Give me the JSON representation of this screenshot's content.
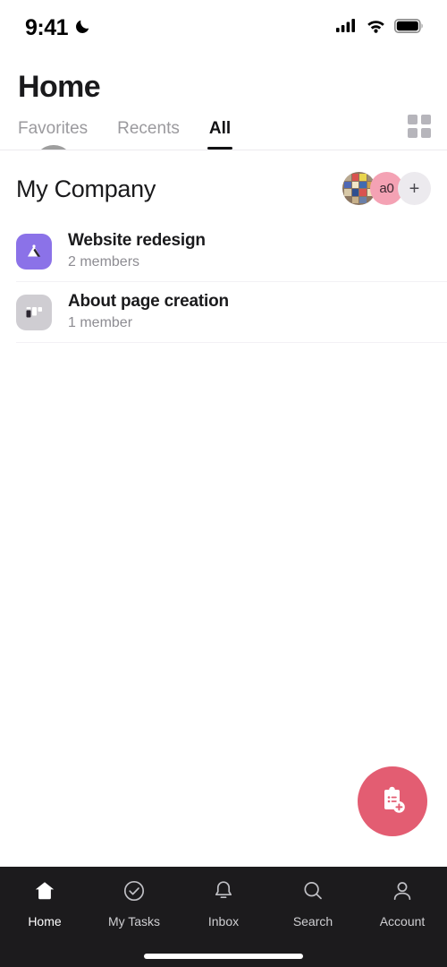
{
  "status_bar": {
    "time": "9:41",
    "dnd_icon": "moon-icon",
    "signal_icon": "cellular-signal-icon",
    "wifi_icon": "wifi-icon",
    "battery_icon": "battery-full-icon"
  },
  "header": {
    "title": "Home",
    "avatar": {
      "name": "user-avatar",
      "color": "#9e9e9e"
    },
    "grid_toggle_icon": "grid-view-icon"
  },
  "tabs": [
    {
      "label": "Favorites",
      "active": false
    },
    {
      "label": "Recents",
      "active": false
    },
    {
      "label": "All",
      "active": true
    }
  ],
  "company": {
    "name": "My Company",
    "members": [
      {
        "type": "photo",
        "name": "member-avatar-photo",
        "label": ""
      },
      {
        "type": "initials",
        "name": "member-avatar-initials",
        "label": "a0",
        "color": "#f4a2b4"
      },
      {
        "type": "add",
        "name": "add-member-button",
        "label": "+",
        "color": "#eceaee"
      }
    ]
  },
  "projects": [
    {
      "title": "Website redesign",
      "members": "2 members",
      "icon": "mountain-icon",
      "icon_color": "#8b72e8"
    },
    {
      "title": "About page creation",
      "members": "1 member",
      "icon": "board-columns-icon",
      "icon_color": "#cfcdd2"
    }
  ],
  "fab": {
    "icon": "new-task-icon",
    "color": "#e35d72"
  },
  "bottom_nav": [
    {
      "label": "Home",
      "icon": "home-icon",
      "active": true
    },
    {
      "label": "My Tasks",
      "icon": "check-circle-icon",
      "active": false
    },
    {
      "label": "Inbox",
      "icon": "bell-icon",
      "active": false
    },
    {
      "label": "Search",
      "icon": "search-icon",
      "active": false
    },
    {
      "label": "Account",
      "icon": "person-icon",
      "active": false
    }
  ]
}
